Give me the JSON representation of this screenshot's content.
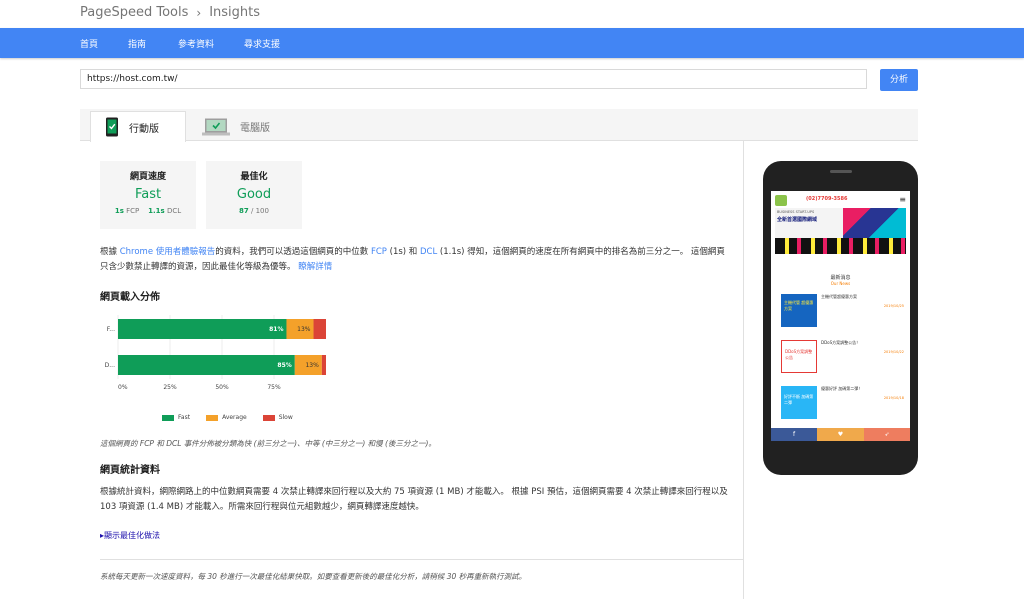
{
  "header": {
    "crumb_root": "PageSpeed Tools",
    "crumb_current": "Insights"
  },
  "nav": {
    "items": [
      "首頁",
      "指南",
      "參考資料",
      "尋求支援"
    ]
  },
  "search": {
    "url": "https://host.com.tw/",
    "analyze_label": "分析"
  },
  "tabs": {
    "mobile": "行動版",
    "desktop": "電腦版"
  },
  "scores": {
    "speed": {
      "title": "網頁速度",
      "value": "Fast",
      "fcp": "1s",
      "fcp_label": "FCP",
      "dcl": "1.1s",
      "dcl_label": "DCL"
    },
    "optimization": {
      "title": "最佳化",
      "value": "Good",
      "score": "87",
      "out_of": "/ 100"
    }
  },
  "summary": {
    "text_a": "根據 ",
    "link_crux": "Chrome 使用者體驗報告",
    "text_b": "的資料，我們可以透過這個網頁的中位數 ",
    "fcp": "FCP",
    "text_c": " (1s) 和 ",
    "dcl": "DCL",
    "text_d": " (1.1s) 得知，這個網頁的速度在所有網頁中的排名為前三分之一。 這個網頁只含少數禁止轉譯的資源，因此最佳化等級為優等。",
    "learn_more": "瞭解詳情"
  },
  "distribution": {
    "heading": "網頁載入分佈"
  },
  "chart_data": {
    "type": "bar",
    "orientation": "horizontal",
    "stacked": true,
    "categories": [
      "F...",
      "D..."
    ],
    "series": [
      {
        "name": "Fast",
        "values": [
          81,
          85
        ],
        "color": "#0f9d58"
      },
      {
        "name": "Average",
        "values": [
          13,
          13
        ],
        "color": "#f4a12a"
      },
      {
        "name": "Slow",
        "values": [
          6,
          2
        ],
        "color": "#db4437"
      }
    ],
    "data_labels": [
      [
        "81%",
        "13%",
        ""
      ],
      [
        "85%",
        "13%",
        ""
      ]
    ],
    "xticks": [
      "0%",
      "25%",
      "50%",
      "75%"
    ],
    "xlim": [
      0,
      100
    ],
    "legend": "bottom"
  },
  "chart_note": "這個網頁的 FCP 和 DCL 事件分佈被分類為快 (前三分之一)、中等 (中三分之一) 和慢 (後三分之一)。",
  "stats": {
    "heading": "網頁統計資料",
    "text": "根據統計資料，網際網路上的中位數網頁需要 4 次禁止轉譯來回行程以及大約 75 項資源 (1 MB) 才能載入。 根據 PSI 預估，這個網頁需要 4 次禁止轉譯來回行程以及 103 項資源 (1.4 MB) 才能載入。所需來回行程與位元組數越少，網頁轉譯速度越快。",
    "show_link": "顯示最佳化做法"
  },
  "footer_note": "系統每天更新一次速度資料，每 30 秒進行一次最佳化結果快取。如要查看更新後的最佳化分析，請稍候 30 秒再重新執行測試。",
  "preview": {
    "phone_label": "(02)7709-3586",
    "banner": "全新首選國際網域",
    "banner_sub": "BUSINESS START-UPS",
    "news_title": "最新消息",
    "news_sub": "Our News",
    "news": [
      {
        "title": "主機代管超優惠方案",
        "date": "2019/10/25",
        "thumb": "主機代管 超優惠方案"
      },
      {
        "title": "DDoS方案調整公告！",
        "date": "2019/10/22",
        "thumb": "DDoS方案調整公告"
      },
      {
        "title": "優惠好評 加碼第二彈！",
        "date": "2019/10/18",
        "thumb": "好評不斷 加碼第二彈"
      }
    ],
    "bottom_icons": [
      "f",
      "♥",
      "➶"
    ],
    "colors": {
      "facebook": "#3b5998",
      "mid": "#f0a94b",
      "share": "#ee7d5f"
    }
  }
}
